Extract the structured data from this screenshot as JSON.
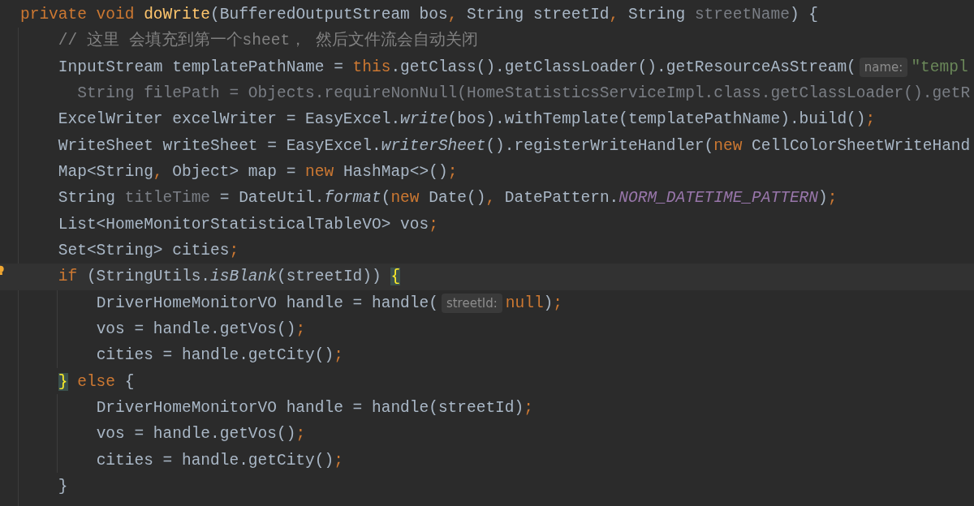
{
  "editor": {
    "lines": [
      {
        "current": false,
        "segments": [
          {
            "kind": "code",
            "tokens": [
              {
                "text": "private",
                "kind": "keyword"
              },
              {
                "text": " void",
                "kind": "keyword"
              },
              {
                "text": " doWrite",
                "kind": "decl"
              },
              {
                "text": "(BufferedOutputStream bos",
                "kind": "plain"
              },
              {
                "text": ",",
                "kind": "punct"
              },
              {
                "text": " String streetId",
                "kind": "plain"
              },
              {
                "text": ",",
                "kind": "punct"
              },
              {
                "text": " String",
                "kind": "plain"
              },
              {
                "text": " streetName",
                "kind": "unused"
              },
              {
                "text": ") {",
                "kind": "plain"
              }
            ]
          }
        ]
      },
      {
        "current": false,
        "segments": [
          {
            "kind": "code",
            "tokens": [
              {
                "text": "    // 这里 会填充到第一个sheet， 然后文件流会自动关闭",
                "kind": "comment"
              }
            ]
          }
        ]
      },
      {
        "current": false,
        "segments": [
          {
            "kind": "code",
            "tokens": [
              {
                "text": "    InputStream templatePathName = ",
                "kind": "plain"
              },
              {
                "text": "this",
                "kind": "keyword"
              },
              {
                "text": ".getClass().getClassLoader().getResourceAsStream(",
                "kind": "plain"
              }
            ]
          },
          {
            "kind": "hint",
            "text": "name:"
          },
          {
            "kind": "code",
            "tokens": [
              {
                "text": "\"templ",
                "kind": "string"
              }
            ]
          }
        ]
      },
      {
        "current": false,
        "segments": [
          {
            "kind": "code",
            "tokens": [
              {
                "text": "      String filePath = Objects.requireNonNull(HomeStatisticsServiceImpl.class.getClassLoader().getR",
                "kind": "unused"
              }
            ]
          }
        ]
      },
      {
        "current": false,
        "segments": [
          {
            "kind": "code",
            "tokens": [
              {
                "text": "    ExcelWriter excelWriter = EasyExcel.",
                "kind": "plain"
              },
              {
                "text": "write",
                "kind": "static"
              },
              {
                "text": "(bos).withTemplate(templatePathName).build()",
                "kind": "plain"
              },
              {
                "text": ";",
                "kind": "punct"
              }
            ]
          }
        ]
      },
      {
        "current": false,
        "segments": [
          {
            "kind": "code",
            "tokens": [
              {
                "text": "    WriteSheet writeSheet = EasyExcel.",
                "kind": "plain"
              },
              {
                "text": "writerSheet",
                "kind": "static"
              },
              {
                "text": "().registerWriteHandler(",
                "kind": "plain"
              },
              {
                "text": "new",
                "kind": "keyword"
              },
              {
                "text": " CellColorSheetWriteHand",
                "kind": "plain"
              }
            ]
          }
        ]
      },
      {
        "current": false,
        "segments": [
          {
            "kind": "code",
            "tokens": [
              {
                "text": "    Map<String",
                "kind": "plain"
              },
              {
                "text": ",",
                "kind": "punct"
              },
              {
                "text": " Object> map = ",
                "kind": "plain"
              },
              {
                "text": "new",
                "kind": "keyword"
              },
              {
                "text": " HashMap<>()",
                "kind": "plain"
              },
              {
                "text": ";",
                "kind": "punct"
              }
            ]
          }
        ]
      },
      {
        "current": false,
        "segments": [
          {
            "kind": "code",
            "tokens": [
              {
                "text": "    String",
                "kind": "plain"
              },
              {
                "text": " titleTime",
                "kind": "unused"
              },
              {
                "text": " = DateUtil.",
                "kind": "plain"
              },
              {
                "text": "format",
                "kind": "static"
              },
              {
                "text": "(",
                "kind": "plain"
              },
              {
                "text": "new",
                "kind": "keyword"
              },
              {
                "text": " Date()",
                "kind": "plain"
              },
              {
                "text": ",",
                "kind": "punct"
              },
              {
                "text": " DatePattern.",
                "kind": "plain"
              },
              {
                "text": "NORM_DATETIME_PATTERN",
                "kind": "const"
              },
              {
                "text": ")",
                "kind": "plain"
              },
              {
                "text": ";",
                "kind": "punct"
              }
            ]
          }
        ]
      },
      {
        "current": false,
        "segments": [
          {
            "kind": "code",
            "tokens": [
              {
                "text": "    List<HomeMonitorStatisticalTableVO> vos",
                "kind": "plain"
              },
              {
                "text": ";",
                "kind": "punct"
              }
            ]
          }
        ]
      },
      {
        "current": false,
        "segments": [
          {
            "kind": "code",
            "tokens": [
              {
                "text": "    Set<String> cities",
                "kind": "plain"
              },
              {
                "text": ";",
                "kind": "punct"
              }
            ]
          }
        ]
      },
      {
        "current": true,
        "segments": [
          {
            "kind": "code",
            "tokens": [
              {
                "text": "    if",
                "kind": "keyword"
              },
              {
                "text": " (StringUtils.",
                "kind": "plain"
              },
              {
                "text": "isBlank",
                "kind": "static"
              },
              {
                "text": "(streetId)) ",
                "kind": "plain"
              },
              {
                "text": "{",
                "kind": "brace"
              }
            ]
          }
        ]
      },
      {
        "current": false,
        "segments": [
          {
            "kind": "code",
            "tokens": [
              {
                "text": "        DriverHomeMonitorVO handle = handle(",
                "kind": "plain"
              }
            ]
          },
          {
            "kind": "hint",
            "text": "streetId:"
          },
          {
            "kind": "code",
            "tokens": [
              {
                "text": "null",
                "kind": "keyword"
              },
              {
                "text": ")",
                "kind": "plain"
              },
              {
                "text": ";",
                "kind": "punct"
              }
            ]
          }
        ]
      },
      {
        "current": false,
        "segments": [
          {
            "kind": "code",
            "tokens": [
              {
                "text": "        vos = handle.getVos()",
                "kind": "plain"
              },
              {
                "text": ";",
                "kind": "punct"
              }
            ]
          }
        ]
      },
      {
        "current": false,
        "segments": [
          {
            "kind": "code",
            "tokens": [
              {
                "text": "        cities = handle.getCity()",
                "kind": "plain"
              },
              {
                "text": ";",
                "kind": "punct"
              }
            ]
          }
        ]
      },
      {
        "current": false,
        "segments": [
          {
            "kind": "code",
            "tokens": [
              {
                "text": "    }",
                "kind": "brace"
              },
              {
                "text": " else",
                "kind": "keyword"
              },
              {
                "text": " {",
                "kind": "plain"
              }
            ]
          }
        ]
      },
      {
        "current": false,
        "segments": [
          {
            "kind": "code",
            "tokens": [
              {
                "text": "        DriverHomeMonitorVO handle = handle(streetId)",
                "kind": "plain"
              },
              {
                "text": ";",
                "kind": "punct"
              }
            ]
          }
        ]
      },
      {
        "current": false,
        "segments": [
          {
            "kind": "code",
            "tokens": [
              {
                "text": "        vos = handle.getVos()",
                "kind": "plain"
              },
              {
                "text": ";",
                "kind": "punct"
              }
            ]
          }
        ]
      },
      {
        "current": false,
        "segments": [
          {
            "kind": "code",
            "tokens": [
              {
                "text": "        cities = handle.getCity()",
                "kind": "plain"
              },
              {
                "text": ";",
                "kind": "punct"
              }
            ]
          }
        ]
      },
      {
        "current": false,
        "segments": [
          {
            "kind": "code",
            "tokens": [
              {
                "text": "    }",
                "kind": "plain"
              }
            ]
          }
        ]
      }
    ]
  }
}
